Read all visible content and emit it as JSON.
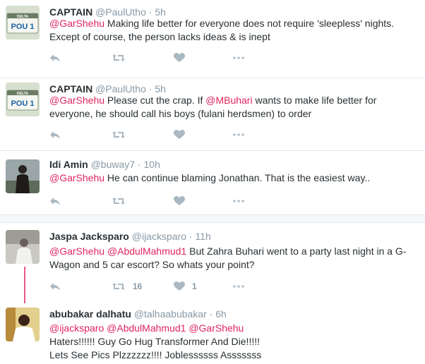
{
  "colors": {
    "mention": "#e0245e",
    "meta": "#8899a6",
    "icon": "#aab8c2",
    "divider": "#e1e8ed"
  },
  "tweets": [
    {
      "name": "CAPTAIN",
      "handle": "@PaulUtho",
      "dot": "·",
      "time": "5h",
      "avatar_text": "POU 1",
      "avatar_top": "DELTA",
      "mention1": "@GarShehu",
      "text_line1": " Making life better for everyone does not require 'sleepless' nights.",
      "text_line2": "Except of course, the person lacks ideas & is inept"
    },
    {
      "name": "CAPTAIN",
      "handle": "@PaulUtho",
      "dot": "·",
      "time": "5h",
      "avatar_text": "POU 1",
      "avatar_top": "DELTA",
      "mention1": "@GarShehu",
      "text_a": " Please cut the crap. If ",
      "mention2": "@MBuhari",
      "text_b": " wants to make life better for",
      "text_line2": "everyone, he should call his boys (fulani herdsmen) to order"
    },
    {
      "name": "Idi Amin",
      "handle": "@buway7",
      "dot": "·",
      "time": "10h",
      "mention1": "@GarShehu",
      "text_a": " He can continue blaming Jonathan. That is the easiest way.."
    },
    {
      "name": "Jaspa Jacksparo",
      "handle": "@ijacksparo",
      "dot": "·",
      "time": "11h",
      "mention1": "@GarShehu",
      "mention2": "@AbdulMahmud1",
      "text_a": " But Zahra Buhari went to a party last night in a G-",
      "text_line2": "Wagon and 5 car escort? So whats your point?",
      "retweets": "16",
      "likes": "1"
    },
    {
      "name": "abubakar dalhatu",
      "handle": "@talhaabubakar",
      "dot": "·",
      "time": "6h",
      "mention1": "@ijacksparo",
      "mention2": "@AbdulMahmud1",
      "mention3": "@GarShehu",
      "text_line2": "Haters!!!!!! Guy Go Hug Transformer And Die!!!!!",
      "text_line3": "Lets See Pics Plzzzzzz!!!! Joblessssss Asssssss"
    }
  ],
  "icons": {
    "reply": "reply-icon",
    "retweet": "retweet-icon",
    "like": "heart-icon",
    "more": "more-icon"
  }
}
